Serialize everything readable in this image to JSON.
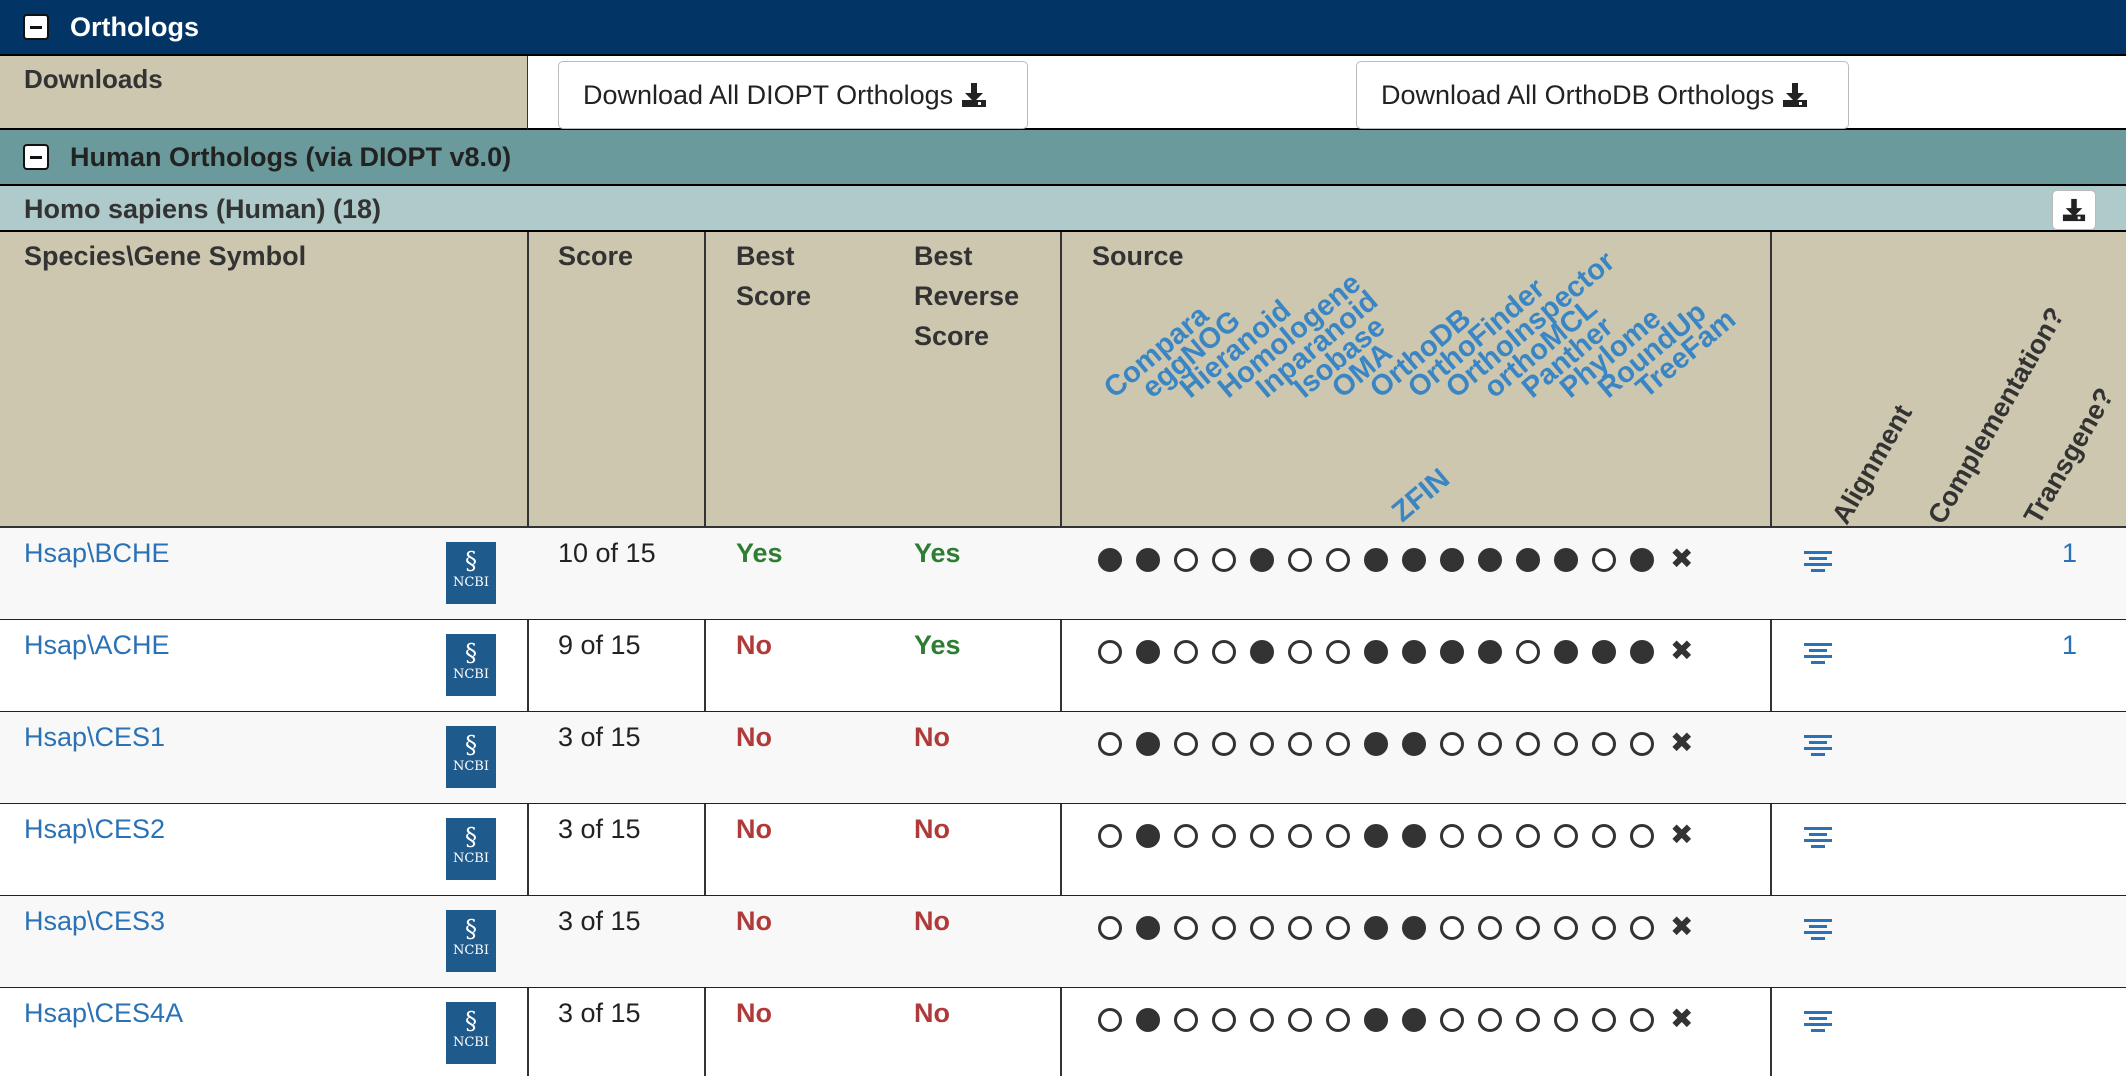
{
  "header": {
    "title": "Orthologs",
    "toggle_icon": "minus-box-icon"
  },
  "downloads": {
    "label": "Downloads",
    "diopt_button": "Download All DIOPT Orthologs",
    "orthodb_button": "Download All OrthoDB Orthologs",
    "icon": "download-icon"
  },
  "section": {
    "title": "Human Orthologs (via DIOPT v8.0)"
  },
  "species": {
    "title": "Homo sapiens (Human) (18)"
  },
  "columns": {
    "species_gene": "Species\\Gene Symbol",
    "score": "Score",
    "best_score_1": "Best",
    "best_score_2": "Score",
    "best_rev_1": "Best",
    "best_rev_2": "Reverse",
    "best_rev_3": "Score",
    "source": "Source",
    "alignment": "Alignment",
    "complementation": "Complementation?",
    "transgene": "Transgene?"
  },
  "sources": [
    "Compara",
    "eggNOG",
    "Hieranoid",
    "Homologene",
    "Inparanoid",
    "Isobase",
    "OMA",
    "OrthoDB",
    "OrthoFinder",
    "OrthoInspector",
    "orthoMCL",
    "Panther",
    "Phylome",
    "RoundUp",
    "TreeFam",
    "ZFIN"
  ],
  "rows": [
    {
      "gene": "Hsap\\BCHE",
      "score": "10 of 15",
      "best": "Yes",
      "best_rev": "Yes",
      "dots": [
        1,
        1,
        0,
        0,
        1,
        0,
        0,
        1,
        1,
        1,
        1,
        1,
        1,
        0,
        1
      ],
      "transgene": "1"
    },
    {
      "gene": "Hsap\\ACHE",
      "score": "9 of 15",
      "best": "No",
      "best_rev": "Yes",
      "dots": [
        0,
        1,
        0,
        0,
        1,
        0,
        0,
        1,
        1,
        1,
        1,
        0,
        1,
        1,
        1
      ],
      "transgene": "1"
    },
    {
      "gene": "Hsap\\CES1",
      "score": "3 of 15",
      "best": "No",
      "best_rev": "No",
      "dots": [
        0,
        1,
        0,
        0,
        0,
        0,
        0,
        1,
        1,
        0,
        0,
        0,
        0,
        0,
        0
      ],
      "transgene": ""
    },
    {
      "gene": "Hsap\\CES2",
      "score": "3 of 15",
      "best": "No",
      "best_rev": "No",
      "dots": [
        0,
        1,
        0,
        0,
        0,
        0,
        0,
        1,
        1,
        0,
        0,
        0,
        0,
        0,
        0
      ],
      "transgene": ""
    },
    {
      "gene": "Hsap\\CES3",
      "score": "3 of 15",
      "best": "No",
      "best_rev": "No",
      "dots": [
        0,
        1,
        0,
        0,
        0,
        0,
        0,
        1,
        1,
        0,
        0,
        0,
        0,
        0,
        0
      ],
      "transgene": ""
    },
    {
      "gene": "Hsap\\CES4A",
      "score": "3 of 15",
      "best": "No",
      "best_rev": "No",
      "dots": [
        0,
        1,
        0,
        0,
        0,
        0,
        0,
        1,
        1,
        0,
        0,
        0,
        0,
        0,
        0
      ],
      "transgene": ""
    }
  ],
  "ncbi_label": "NCBI",
  "colors": {
    "header": "#023466",
    "section": "#6a9a9b",
    "species_bar": "#aecacb",
    "table_header": "#cdc7b0",
    "link": "#2a72b5",
    "yes": "#2f7d32",
    "no": "#b03a3a"
  }
}
